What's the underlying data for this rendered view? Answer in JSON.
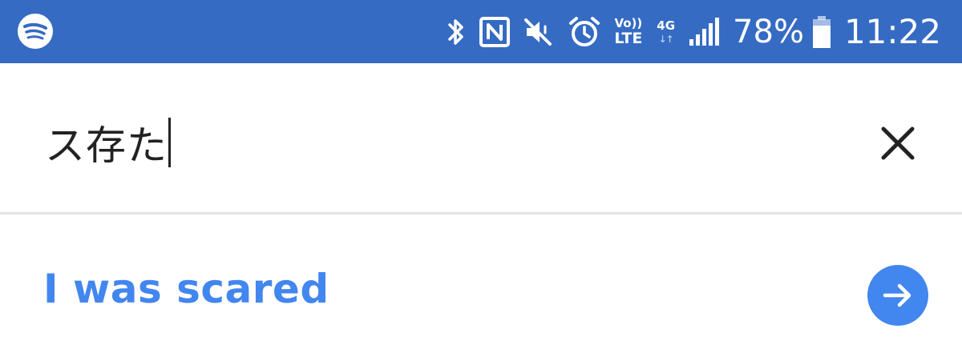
{
  "status_bar": {
    "app_icon": "spotify-icon",
    "icons": [
      "bluetooth-icon",
      "nfc-icon",
      "mute-icon",
      "alarm-icon"
    ],
    "volte_line1": "Vo))",
    "volte_line2": "LTE",
    "network_type": "4G",
    "network_arrows": "↓↑",
    "signal_icon": "signal-bars-icon",
    "battery_percent": "78%",
    "battery_icon": "battery-icon",
    "time": "11:22",
    "background_color": "#356bc3"
  },
  "search": {
    "query": "ス存た",
    "clear_icon": "close-icon"
  },
  "suggestion": {
    "text": "I was scared",
    "action_icon": "arrow-right-icon",
    "accent_color": "#4286ef"
  }
}
